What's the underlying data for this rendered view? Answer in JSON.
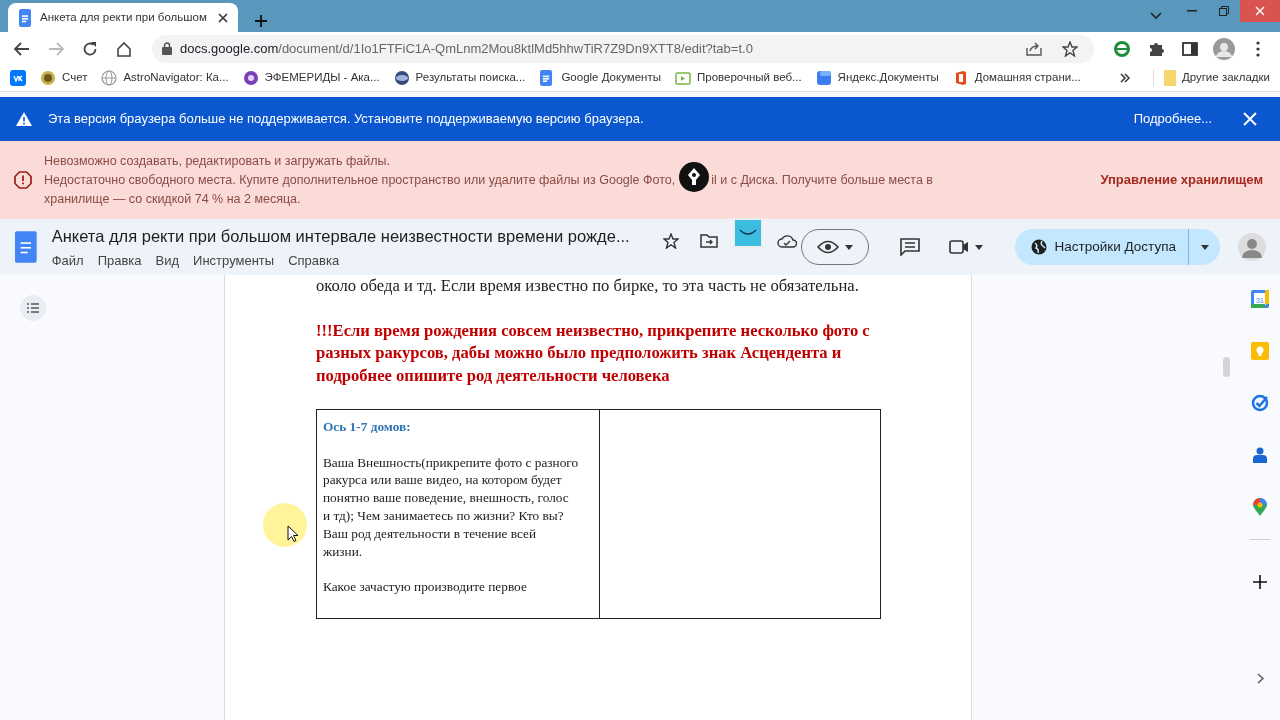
{
  "browser": {
    "tabs": [
      {
        "title": "Анкета для ректи при большом",
        "selected": true
      }
    ],
    "url_host": "docs.google.com",
    "url_path": "/document/d/1Io1FTFiC1A-QmLnm2Mou8ktlMd5hhwTiR7Z9Dn9XTT8/edit?tab=t.0",
    "bookmarks": [
      {
        "kind": "vk"
      },
      {
        "kind": "coin",
        "label": "Счет"
      },
      {
        "kind": "globe",
        "label": "AstroNavigator: Ка..."
      },
      {
        "kind": "purple",
        "label": "ЭФЕМЕРИДЫ - Ака..."
      },
      {
        "kind": "search",
        "label": "Результаты поиска..."
      },
      {
        "kind": "docs",
        "label": "Google Документы"
      },
      {
        "kind": "test",
        "label": "Проверочный веб..."
      },
      {
        "kind": "yadocs",
        "label": "Яндекс.Документы"
      },
      {
        "kind": "office",
        "label": "Домашняя страни..."
      }
    ],
    "other_bookmarks": "Другие закладки"
  },
  "update_banner": {
    "text": "Эта версия браузера больше не поддерживается. Установите поддерживаемую версию браузера.",
    "link": "Подробнее..."
  },
  "storage_banner": {
    "title": "Невозможно создавать, редактировать и загружать файлы.",
    "detail_before": "Недостаточно свободного места. Купите дополнительное пространство или удалите файлы из Google Фото,",
    "detail_after": "il и с Диска. Получите больше места в",
    "detail_line2": "хранилище — со скидкой 74 % на 2 месяца.",
    "action": "Управление хранилищем"
  },
  "docs": {
    "title": "Анкета для ректи при большом интервале неизвестности времени рожде...",
    "menu": [
      "Файл",
      "Правка",
      "Вид",
      "Инструменты",
      "Справка"
    ],
    "share_button": "Настройки Доступа"
  },
  "document": {
    "paragraphs": [
      {
        "kind": "normal",
        "text": "около обеда и тд. Если время известно по бирке, то эта часть не обязательна."
      },
      {
        "kind": "warning",
        "text": "!!!Если время рождения совсем неизвестно, прикрепите несколько фото с разных ракурсов, дабы можно было предположить знак Асцендента и подробнее опишите род деятельности человека"
      }
    ],
    "table": {
      "rows": [
        {
          "heading": "Ось 1-7 домов:",
          "paragraphs": [
            "Ваша Внешность(прикрепите фото с разного ракурса или ваше видео, на котором будет понятно ваше поведение, внешность, голос и тд); Чем занимаетесь по жизни? Кто вы? Ваш род деятельности в течение всей жизни.",
            "Какое зачастую производите первое"
          ]
        }
      ]
    }
  },
  "side_panel": {
    "calendar_day": "31"
  }
}
